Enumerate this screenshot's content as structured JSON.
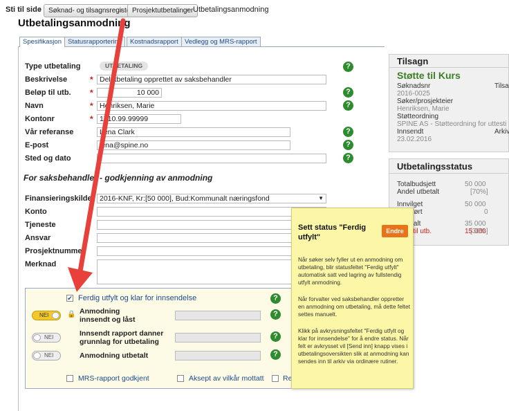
{
  "breadcrumb": {
    "label": "Sti til side",
    "sep": "»",
    "link1": "Søknad- og tilsagnsregister",
    "link2": "Prosjektutbetalinger",
    "current": "Utbetalingsanmodning"
  },
  "page_title": "Utbetalingsanmodning",
  "tabs": [
    "Spesifikasjon",
    "Statusrapportering",
    "Kostnadsrapport",
    "Vedlegg og MRS-rapport"
  ],
  "form": {
    "type_label": "Type utbetaling",
    "type_value": "UTBETALING",
    "beskrivelse_label": "Beskrivelse",
    "beskrivelse_value": "Delutbetaling opprettet av saksbehandler",
    "belop_label": "Beløp til utb.",
    "belop_value": "10 000",
    "navn_label": "Navn",
    "navn_value": "Henriksen, Marie",
    "kontonr_label": "Kontonr",
    "kontonr_value": "1710.99.99999",
    "ref_label": "Vår referanse",
    "ref_value": "Lena Clark",
    "epost_label": "E-post",
    "epost_value": "lena@spine.no",
    "sted_label": "Sted og dato",
    "sted_value": "",
    "required_mark": "*"
  },
  "saksbehandler": {
    "heading": "For saksbehandler - godkjenning av anmodning",
    "finans_label": "Finansieringskilde",
    "finans_value": "2016-KNF, Kr:[50 000], Bud:Kommunalt næringsfond",
    "konto_label": "Konto",
    "tjeneste_label": "Tjeneste",
    "ansvar_label": "Ansvar",
    "prosjekt_label": "Prosjektnummer",
    "merknad_label": "Merknad"
  },
  "status_box": {
    "ferdig_label": "Ferdig utfylt og klar for innsendelse",
    "ferdig_checked": true,
    "rows": [
      {
        "toggle": "NEI",
        "label1": "Anmodning",
        "label2": "innsendt og låst"
      },
      {
        "toggle": "NEI",
        "label1": "Innsendt rapport danner",
        "label2": "grunnlag for utbetaling"
      },
      {
        "toggle": "NEI",
        "label1": "Anmodning utbetalt",
        "label2": ""
      }
    ],
    "mrs_label": "MRS-rapport godkjent",
    "aksept_label": "Aksept av vilkår mottatt",
    "re_label": "Re"
  },
  "tilsagn": {
    "title": "Tilsagn",
    "name": "Støtte til Kurs",
    "soknadsnr_label": "Søknadsnr",
    "soknadsnr_value": "2016-0025",
    "tilsa_label": "Tilsa",
    "soker_label": "Søker/prosjekteier",
    "soker_value": "Henriksen, Marie",
    "stotte_label": "Støtteordning",
    "stotte_value": "SPINE AS - Støtteordning for uttesti",
    "innsendt_label": "Innsendt",
    "innsendt_value": "23.02.2016",
    "arkiv_label": "Arkiv"
  },
  "utbetalingsstatus": {
    "title": "Utbetalingsstatus",
    "totalbudsjett_label": "Totalbudsjett",
    "totalbudsjett_value": "50 000",
    "andel_label": "Andel utbetalt",
    "andel_value": "[70%]",
    "innvilget_label": "Innvilget",
    "innvilget_value": "50 000",
    "overfort_label": "Overført",
    "overfort_value": "0",
    "utbetalt_label": "Utbetalt",
    "utbetalt_value": "35 000",
    "rest_label": "Rest til utb.",
    "rest_value": "15 000",
    "rest_pct": "[30%]"
  },
  "tooltip": {
    "title": "Sett status \"Ferdig utfylt\"",
    "button": "Endre",
    "p1": "Når søker selv fyller ut en anmodning om utbetaling, blir statusfeltet \"Ferdig utfylt\" automatisk satt ved lagring av fullstendig utfylt anmodning.",
    "p2": "Når forvalter ved saksbehandler oppretter en anmodning om utbetaling, må dette feltet settes manuelt.",
    "p3": "Klikk på avkrysningsfeltet \"Ferdig utfylt og klar for innsendelse\" for å endre status. Når felt er avkrysset vil [Send inn] knapp vises i utbetalingsoversikten slik at anmodning kan sendes inn til arkiv via ordinære rutiner."
  },
  "icons": {
    "help": "?",
    "lock": "🔒"
  },
  "colors": {
    "accent_green": "#2e8b2e",
    "title_green": "#3a7d22",
    "tooltip_bg": "#fbf7a6",
    "button_orange": "#e8731a",
    "arrow_red": "#e8403a",
    "rest_red": "#d0201a"
  }
}
